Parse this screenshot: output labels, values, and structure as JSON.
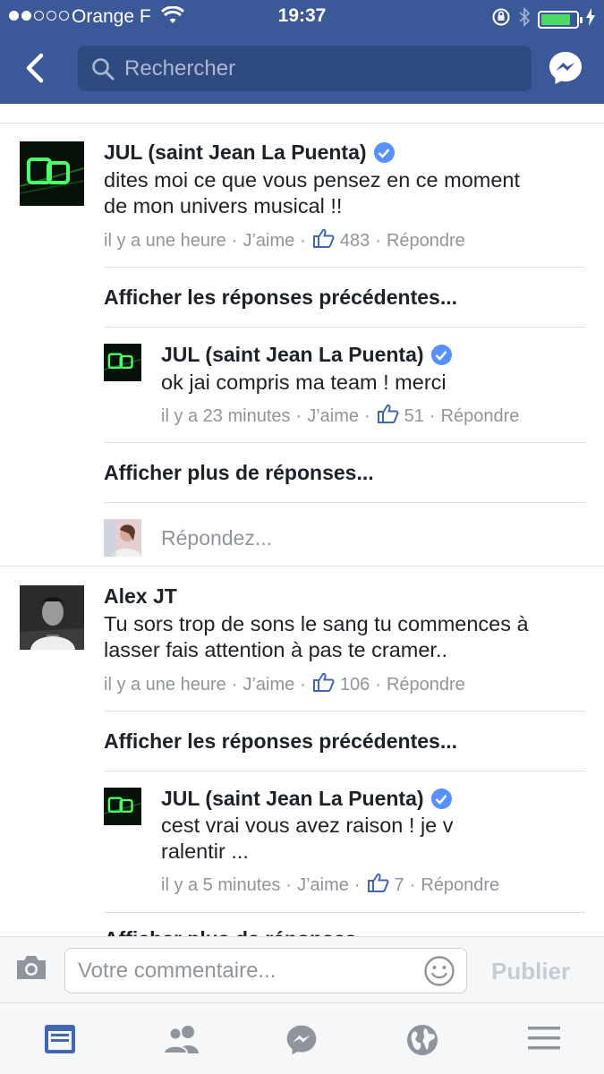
{
  "status_bar": {
    "carrier": "Orange F",
    "time": "19:37"
  },
  "header": {
    "search_placeholder": "Rechercher"
  },
  "comments": [
    {
      "author": "JUL (saint Jean La Puenta)",
      "verified": true,
      "text_lines": [
        "dites moi ce que vous pensez en ce moment",
        "de mon univers musical !!"
      ],
      "time": "il y a une heure",
      "like": "J’aime",
      "likes": "483",
      "reply": "Répondre",
      "previous_replies": "Afficher les réponses précédentes...",
      "replies": [
        {
          "author": "JUL (saint Jean La Puenta)",
          "verified": true,
          "text_lines": [
            "ok jai compris ma team ! merci"
          ],
          "time": "il y a 23 minutes",
          "like": "J’aime",
          "likes": "51",
          "reply": "Répondre"
        }
      ],
      "more_replies": "Afficher plus de réponses...",
      "reply_placeholder": "Répondez..."
    },
    {
      "author": "Alex JT",
      "verified": false,
      "text_lines": [
        "Tu sors trop de sons le sang tu commences à",
        "lasser fais attention à pas te cramer.."
      ],
      "time": "il y a une heure",
      "like": "J’aime",
      "likes": "106",
      "reply": "Répondre",
      "previous_replies": "Afficher les réponses précédentes...",
      "replies": [
        {
          "author": "JUL (saint Jean La Puenta)",
          "verified": true,
          "text_lines": [
            "cest vrai vous avez raison ! je v",
            "ralentir ..."
          ],
          "time": "il y a 5 minutes",
          "like": "J’aime",
          "likes": "7",
          "reply": "Répondre"
        }
      ],
      "more_replies": "Afficher plus de réponses..."
    }
  ],
  "composer": {
    "placeholder": "Votre commentaire...",
    "publish": "Publier"
  },
  "tabs": [
    "feed-icon",
    "friends-icon",
    "messenger-icon",
    "globe-icon",
    "menu-icon"
  ],
  "colors": {
    "brand": "#3b5998",
    "verified": "#5890ff",
    "meta_text": "#90949c",
    "divider": "#dddfe2"
  }
}
